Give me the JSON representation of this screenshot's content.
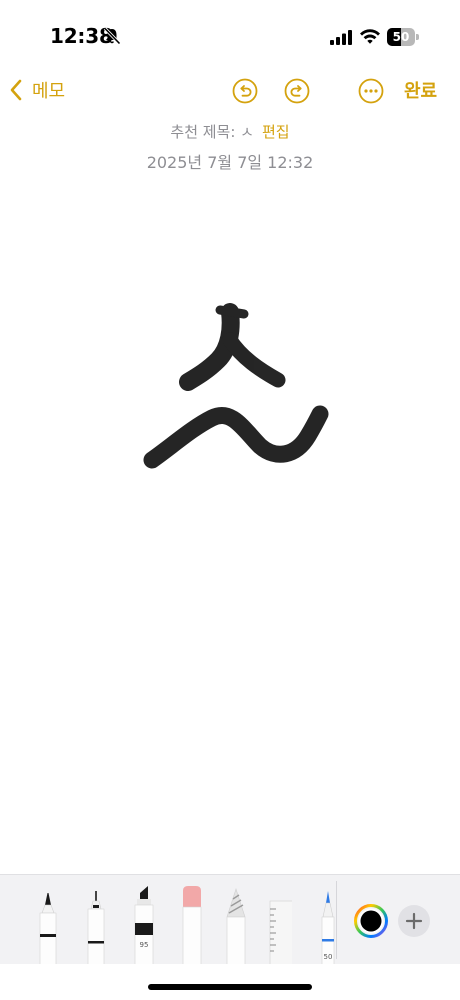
{
  "status_bar": {
    "time": "12:38",
    "battery_percent": 50,
    "battery_label": "50",
    "icons": [
      "bell-off-icon",
      "signal-icon",
      "wifi-icon",
      "battery-icon"
    ]
  },
  "nav": {
    "back_label": "메모",
    "done_label": "완료",
    "icons": [
      "chevron-left-icon",
      "undo-icon",
      "redo-icon",
      "more-icon"
    ]
  },
  "note": {
    "suggested_title_label": "추천 제목: ㅅ",
    "edit_label": "편집",
    "date": "2025년 7월 7일 12:32"
  },
  "toolbar": {
    "tools": [
      {
        "name": "pen",
        "label": ""
      },
      {
        "name": "fineliner",
        "label": ""
      },
      {
        "name": "marker",
        "label": "95"
      },
      {
        "name": "eraser",
        "label": ""
      },
      {
        "name": "lasso",
        "label": ""
      },
      {
        "name": "ruler",
        "label": ""
      },
      {
        "name": "crayon",
        "label": "50"
      }
    ],
    "selected_color": "#000000"
  },
  "colors": {
    "accent": "#d4a20e",
    "secondary_text": "#8e8e93",
    "ink": "#1a1a1a"
  }
}
